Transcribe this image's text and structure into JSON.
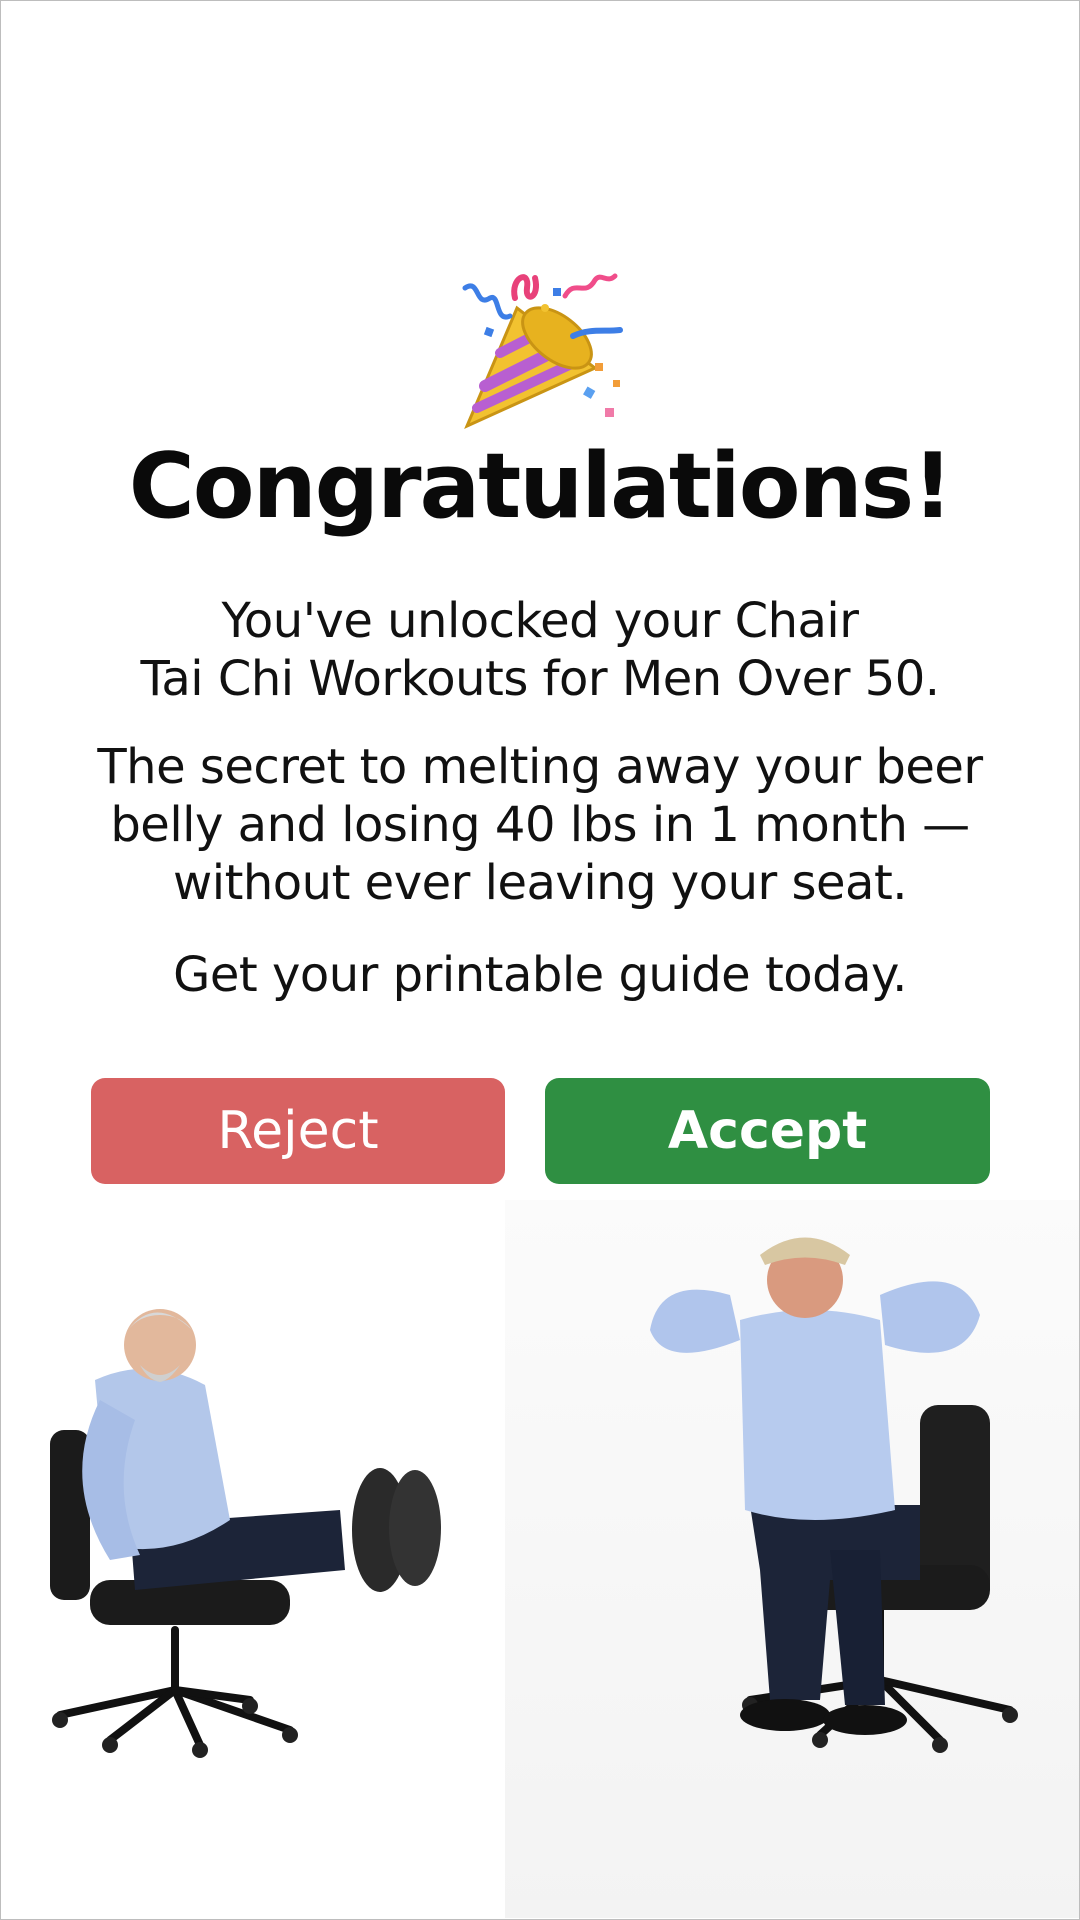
{
  "page": {
    "title": "Congratulations!",
    "line1": "You've unlocked your Chair",
    "line2": "Tai Chi Workouts for Men Over 50.",
    "line3": "The secret to melting away your beer",
    "line4": "belly and losing 40 lbs in 1 month —",
    "line5": "without ever leaving your seat.",
    "line6": "Get your printable guide today."
  },
  "buttons": {
    "reject": "Reject",
    "accept": "Accept"
  },
  "icons": {
    "celebration": "party-popper-icon"
  },
  "colors": {
    "reject": "#d86262",
    "accept": "#2f8f42",
    "text": "#111111",
    "background": "#ffffff"
  }
}
